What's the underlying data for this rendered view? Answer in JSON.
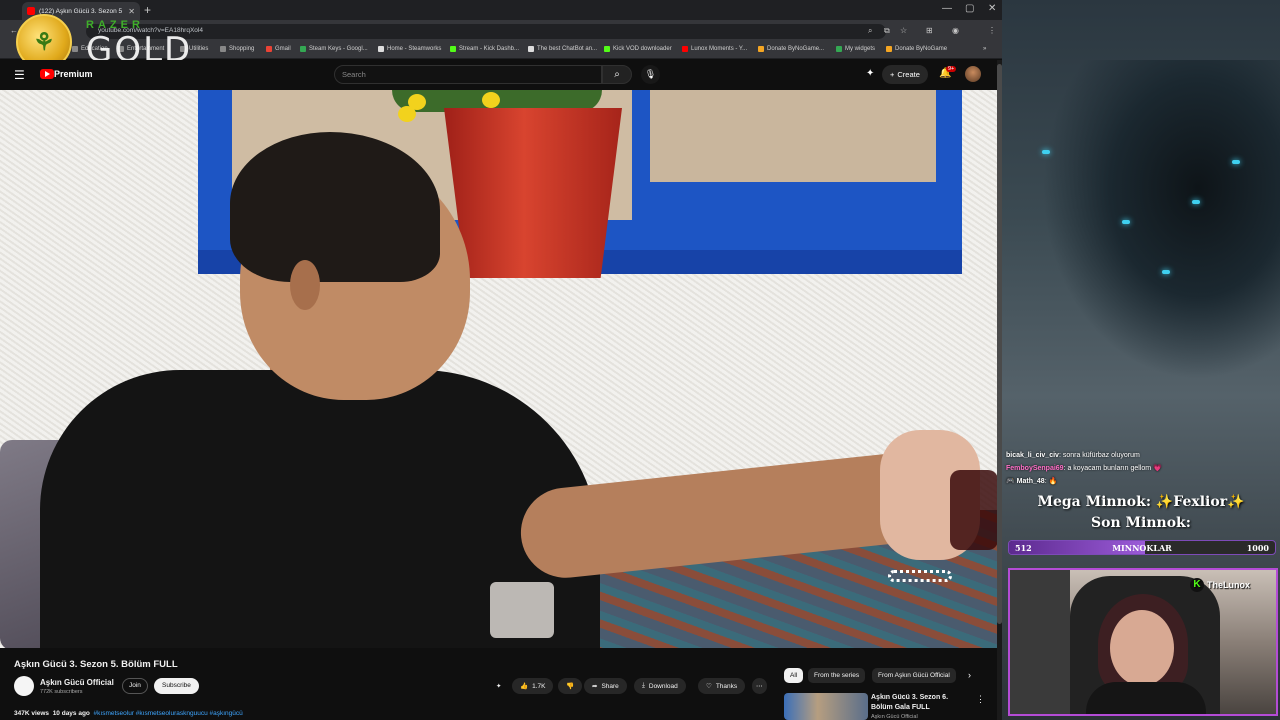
{
  "browser": {
    "tab_title": "(122) Aşkın Gücü 3. Sezon 5",
    "url": "youtube.com/watch?v=EA18hrqXol4",
    "bookmarks": [
      {
        "label": "Education",
        "color": "#888"
      },
      {
        "label": "Entertainment",
        "color": "#888"
      },
      {
        "label": "Utilities",
        "color": "#888"
      },
      {
        "label": "Shopping",
        "color": "#888"
      },
      {
        "label": "Gmail",
        "color": "#ea4335"
      },
      {
        "label": "Steam Keys - Googl...",
        "color": "#34a853"
      },
      {
        "label": "Home - Steamworks",
        "color": "#ddd"
      },
      {
        "label": "Stream - Kick Dashb...",
        "color": "#53fc18"
      },
      {
        "label": "The best ChatBot an...",
        "color": "#ddd"
      },
      {
        "label": "Kick VOD downloader",
        "color": "#53fc18"
      },
      {
        "label": "Lunox Moments - Y...",
        "color": "#ff0000"
      },
      {
        "label": "Donate ByNoGame...",
        "color": "#f5a623"
      },
      {
        "label": "My widgets",
        "color": "#34a853"
      },
      {
        "label": "Donate ByNoGame",
        "color": "#f5a623"
      }
    ]
  },
  "overlay_brand": {
    "razer": "RAZER",
    "gold": "GOLD"
  },
  "youtube": {
    "brand": "Premium",
    "search_placeholder": "Search",
    "create_label": "Create",
    "notification_count": "9+"
  },
  "video": {
    "title": "Aşkın Gücü 3. Sezon 5. Bölüm FULL",
    "channel_name": "Aşkın Gücü Official",
    "channel_subs": "772K subscribers",
    "join_label": "Join",
    "subscribe_label": "Subscribe",
    "likes": "1.7K",
    "share_label": "Share",
    "download_label": "Download",
    "thanks_label": "Thanks",
    "views": "347K views",
    "age": "10 days ago",
    "tags": "#kısmetseolur #kısmetseolurasknguucu #aşkıngücü"
  },
  "recommendations": {
    "chips": [
      "All",
      "From the series",
      "From Aşkın Gücü Official"
    ],
    "first_title": "Aşkın Gücü 3. Sezon 6. Bölüm Gala FULL",
    "first_channel": "Aşkın Gücü Official"
  },
  "stream": {
    "chat": [
      {
        "user": "bicak_li_civ_civ",
        "color": "#ffffff",
        "msg": ": sonra küfürbaz oluyorum"
      },
      {
        "user": "FemboySenpai69",
        "color": "#ff6ec7",
        "msg": ": a koyacam bunların gellom"
      },
      {
        "user": "Math_48",
        "color": "#ffffff",
        "msg": ":"
      }
    ],
    "mega_minnok": "Mega Minnok: ✨Fexlior✨",
    "son_minnok": "Son Minnok:",
    "bar_current": "512",
    "bar_label": "MINNOKLAR",
    "bar_goal": "1000",
    "bar_fraction": 0.512,
    "kick_name": "TheLunox"
  }
}
